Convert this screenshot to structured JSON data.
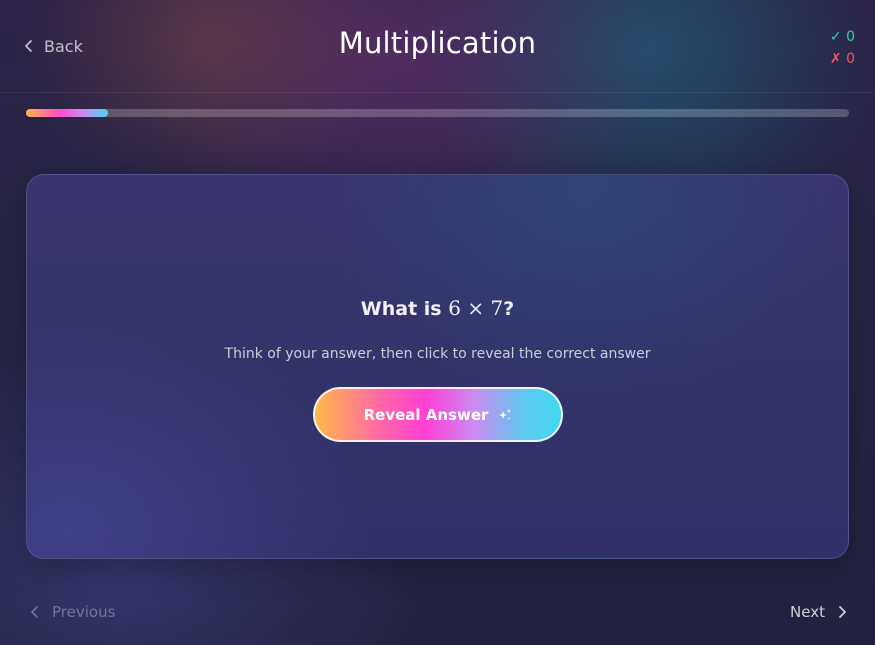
{
  "header": {
    "back_label": "Back",
    "title": "Multiplication",
    "score": {
      "correct_symbol": "✓",
      "correct": "0",
      "wrong_symbol": "✗",
      "wrong": "0"
    }
  },
  "progress": {
    "fraction": 0.1
  },
  "card": {
    "question_prefix": "What is ",
    "question_math": "6 × 7",
    "question_suffix": "?",
    "hint": "Think of your answer, then click to reveal the correct answer",
    "reveal_label": "Reveal Answer"
  },
  "footer": {
    "previous_label": "Previous",
    "next_label": "Next"
  },
  "icons": {
    "back": "chevron-left-icon",
    "reveal": "sparkles-icon",
    "previous": "chevron-left-icon",
    "next": "chevron-right-icon"
  },
  "colors": {
    "correct": "#2dd4a4",
    "wrong": "#f0576b",
    "background": "#22223f"
  }
}
